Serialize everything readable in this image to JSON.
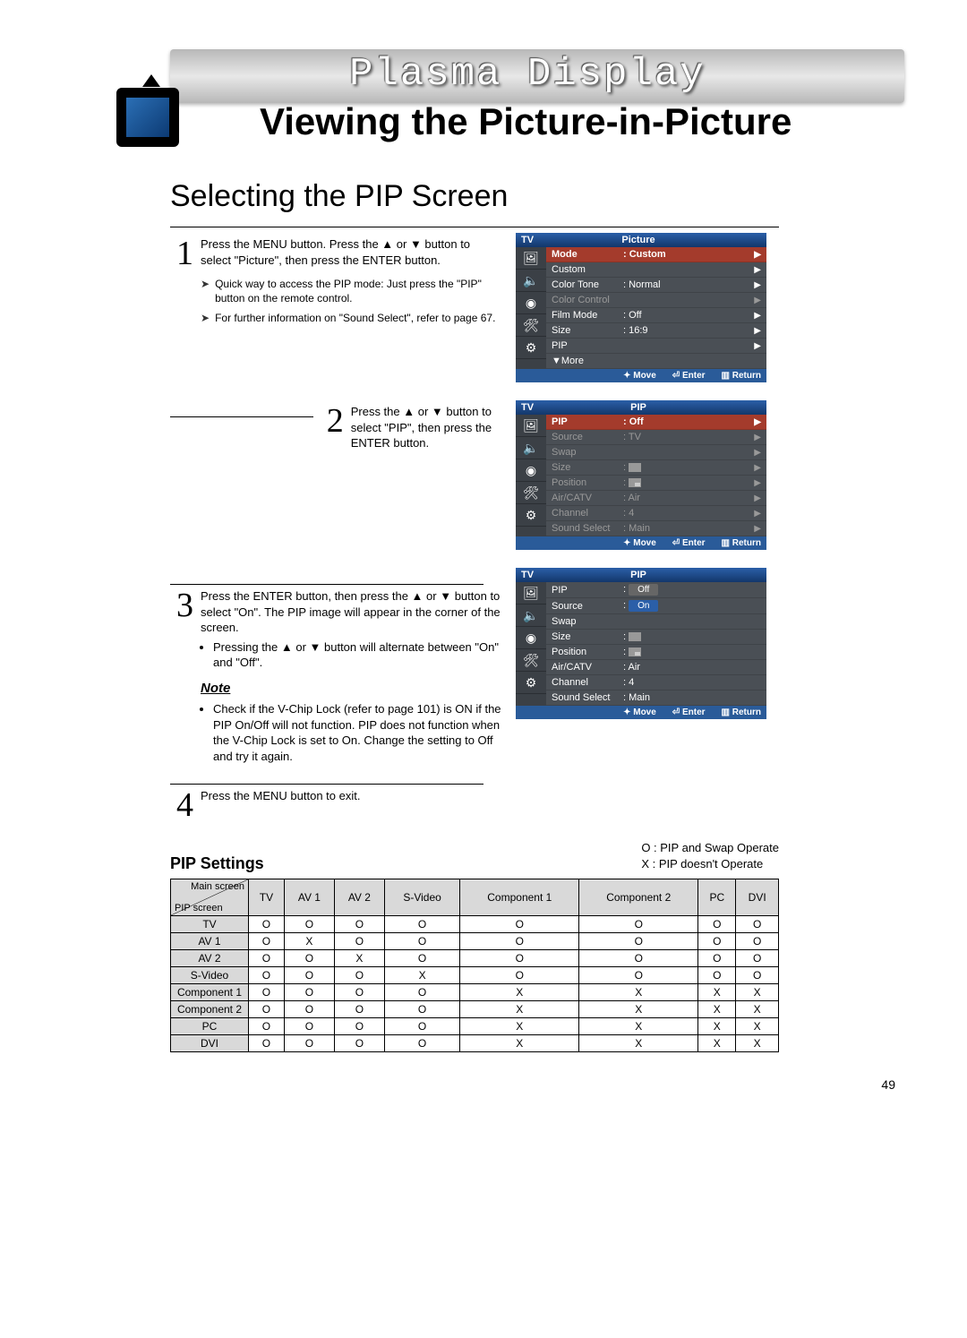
{
  "banner": {
    "surtitle": "Plasma Display",
    "title": "Viewing the Picture-in-Picture"
  },
  "section_heading": "Selecting the PIP Screen",
  "steps": {
    "s1": {
      "num": "1",
      "text": "Press the MENU button. Press the ▲ or ▼ button to select \"Picture\", then press the ENTER button.",
      "tip1": "Quick way to access the PIP mode: Just press the \"PIP\" button on the remote control.",
      "tip2": "For further information on \"Sound Select\", refer to page 67."
    },
    "s2": {
      "num": "2",
      "text": "Press the ▲ or ▼ button to select \"PIP\", then press the ENTER button."
    },
    "s3": {
      "num": "3",
      "text": "Press the ENTER button, then press the ▲ or ▼ button to select \"On\". The PIP image will appear in the corner of the screen.",
      "bullet1": "Pressing the ▲ or ▼ button will alternate between \"On\" and \"Off\".",
      "note_label": "Note",
      "note1": "Check if the V-Chip Lock (refer to page 101) is ON if the PIP On/Off will not function. PIP does not function when the V-Chip Lock is set to On. Change the setting to Off and try it again."
    },
    "s4": {
      "num": "4",
      "text": "Press the MENU button to exit."
    }
  },
  "osd_common": {
    "tv": "TV",
    "move": "Move",
    "enter": "Enter",
    "return": "Return",
    "more": "▼More"
  },
  "osd1": {
    "title": "Picture",
    "rows": {
      "mode": {
        "l": "Mode",
        "v": ": Custom"
      },
      "custom": {
        "l": "Custom",
        "v": ""
      },
      "colortone": {
        "l": "Color Tone",
        "v": ": Normal"
      },
      "colorcontrol": {
        "l": "Color Control",
        "v": ""
      },
      "filmmode": {
        "l": "Film Mode",
        "v": ": Off"
      },
      "size": {
        "l": "Size",
        "v": ": 16:9"
      },
      "pip": {
        "l": "PIP",
        "v": ""
      }
    }
  },
  "osd2": {
    "title": "PIP",
    "rows": {
      "pip": {
        "l": "PIP",
        "v": ": Off"
      },
      "source": {
        "l": "Source",
        "v": ": TV"
      },
      "swap": {
        "l": "Swap",
        "v": ""
      },
      "size": {
        "l": "Size",
        "v": ":"
      },
      "position": {
        "l": "Position",
        "v": ":"
      },
      "aircatv": {
        "l": "Air/CATV",
        "v": ": Air"
      },
      "channel": {
        "l": "Channel",
        "v": ": 4"
      },
      "soundselect": {
        "l": "Sound Select",
        "v": ": Main"
      }
    }
  },
  "osd3": {
    "title": "PIP",
    "rows": {
      "pip": {
        "l": "PIP",
        "v": ":"
      },
      "source": {
        "l": "Source",
        "v": ":"
      },
      "swap": {
        "l": "Swap",
        "v": ""
      },
      "size": {
        "l": "Size",
        "v": ":"
      },
      "position": {
        "l": "Position",
        "v": ":"
      },
      "aircatv": {
        "l": "Air/CATV",
        "v": ": Air"
      },
      "channel": {
        "l": "Channel",
        "v": ": 4"
      },
      "soundselect": {
        "l": "Sound Select",
        "v": ": Main"
      }
    },
    "options": {
      "off": "Off",
      "on": "On"
    }
  },
  "settings": {
    "title": "PIP Settings",
    "legend_o": "O : PIP and Swap Operate",
    "legend_x": "X : PIP doesn't Operate",
    "corner_top": "Main screen",
    "corner_bot": "PIP screen",
    "cols": [
      "TV",
      "AV 1",
      "AV 2",
      "S-Video",
      "Component 1",
      "Component 2",
      "PC",
      "DVI"
    ],
    "rows": [
      {
        "h": "TV",
        "c": [
          "O",
          "O",
          "O",
          "O",
          "O",
          "O",
          "O",
          "O"
        ]
      },
      {
        "h": "AV 1",
        "c": [
          "O",
          "X",
          "O",
          "O",
          "O",
          "O",
          "O",
          "O"
        ]
      },
      {
        "h": "AV 2",
        "c": [
          "O",
          "O",
          "X",
          "O",
          "O",
          "O",
          "O",
          "O"
        ]
      },
      {
        "h": "S-Video",
        "c": [
          "O",
          "O",
          "O",
          "X",
          "O",
          "O",
          "O",
          "O"
        ]
      },
      {
        "h": "Component 1",
        "c": [
          "O",
          "O",
          "O",
          "O",
          "X",
          "X",
          "X",
          "X"
        ]
      },
      {
        "h": "Component 2",
        "c": [
          "O",
          "O",
          "O",
          "O",
          "X",
          "X",
          "X",
          "X"
        ]
      },
      {
        "h": "PC",
        "c": [
          "O",
          "O",
          "O",
          "O",
          "X",
          "X",
          "X",
          "X"
        ]
      },
      {
        "h": "DVI",
        "c": [
          "O",
          "O",
          "O",
          "O",
          "X",
          "X",
          "X",
          "X"
        ]
      }
    ]
  },
  "page_number": "49"
}
